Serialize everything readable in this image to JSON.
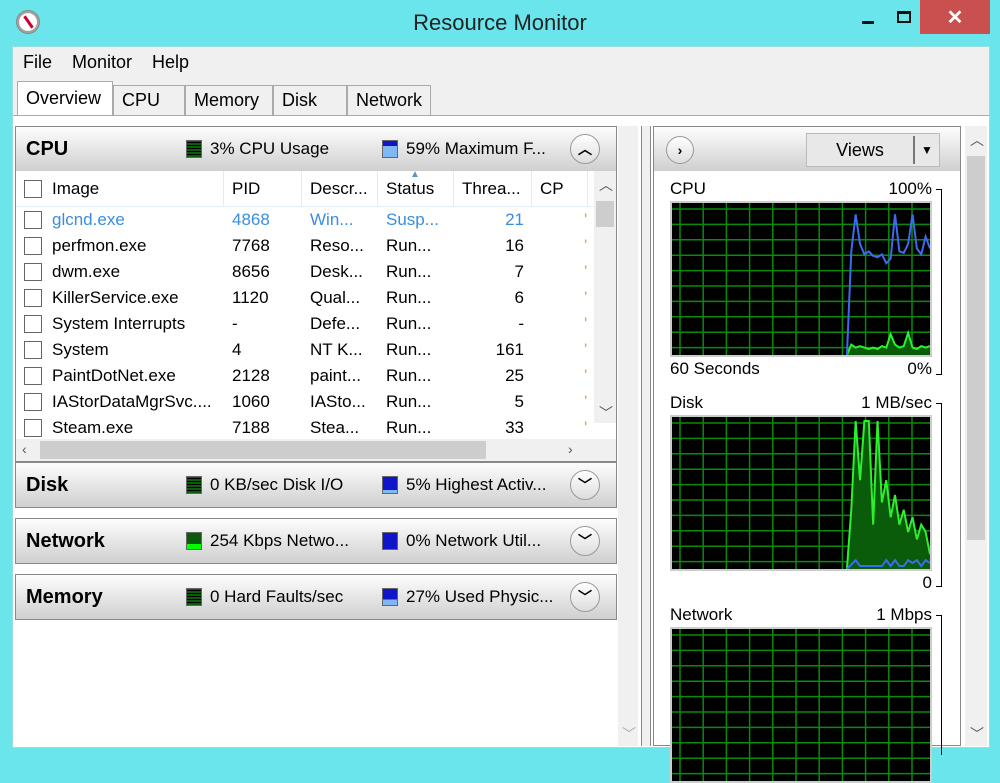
{
  "window": {
    "title": "Resource Monitor",
    "minimize": "–",
    "maximize": "☐",
    "close": "✕"
  },
  "menu": [
    "File",
    "Monitor",
    "Help"
  ],
  "tabs": [
    "Overview",
    "CPU",
    "Memory",
    "Disk",
    "Network"
  ],
  "active_tab": "Overview",
  "sections": {
    "cpu": {
      "name": "CPU",
      "metric1": "3% CPU Usage",
      "metric2": "59% Maximum F...",
      "expanded": true
    },
    "disk": {
      "name": "Disk",
      "metric1": "0 KB/sec Disk I/O",
      "metric2": "5% Highest Activ...",
      "expanded": false
    },
    "network": {
      "name": "Network",
      "metric1": "254 Kbps Netwo...",
      "metric2": "0% Network Util...",
      "expanded": false
    },
    "memory": {
      "name": "Memory",
      "metric1": "0 Hard Faults/sec",
      "metric2": "27% Used Physic...",
      "expanded": false
    }
  },
  "cpu_table": {
    "columns": [
      "Image",
      "PID",
      "Descr...",
      "Status",
      "Threa...",
      "CP"
    ],
    "rows": [
      {
        "image": "glcnd.exe",
        "pid": "4868",
        "desc": "Win...",
        "status": "Susp...",
        "threads": "21",
        "selected": true
      },
      {
        "image": "perfmon.exe",
        "pid": "7768",
        "desc": "Reso...",
        "status": "Run...",
        "threads": "16"
      },
      {
        "image": "dwm.exe",
        "pid": "8656",
        "desc": "Desk...",
        "status": "Run...",
        "threads": "7"
      },
      {
        "image": "KillerService.exe",
        "pid": "1120",
        "desc": "Qual...",
        "status": "Run...",
        "threads": "6"
      },
      {
        "image": "System Interrupts",
        "pid": "-",
        "desc": "Defe...",
        "status": "Run...",
        "threads": "-"
      },
      {
        "image": "System",
        "pid": "4",
        "desc": "NT K...",
        "status": "Run...",
        "threads": "161"
      },
      {
        "image": "PaintDotNet.exe",
        "pid": "2128",
        "desc": "paint...",
        "status": "Run...",
        "threads": "25"
      },
      {
        "image": "IAStorDataMgrSvc....",
        "pid": "1060",
        "desc": "IASto...",
        "status": "Run...",
        "threads": "5"
      },
      {
        "image": "Steam.exe",
        "pid": "7188",
        "desc": "Stea...",
        "status": "Run...",
        "threads": "33"
      }
    ]
  },
  "right_panel": {
    "views_label": "Views"
  },
  "graphs": {
    "cpu": {
      "title": "CPU",
      "max": "100%",
      "footer_left": "60 Seconds",
      "footer_right": "0%",
      "blue": [
        0,
        0,
        0,
        0,
        0,
        0,
        0,
        0,
        0,
        0,
        0,
        0,
        0,
        0,
        0,
        0,
        0,
        0,
        0,
        0,
        0,
        0,
        0,
        0,
        0,
        0,
        0,
        0,
        0,
        0,
        0,
        0,
        0,
        0,
        0,
        0,
        0,
        0,
        0,
        0,
        0,
        70,
        95,
        75,
        68,
        70,
        67,
        66,
        68,
        62,
        65,
        95,
        70,
        69,
        75,
        95,
        72,
        68,
        80,
        72
      ],
      "green": [
        0,
        0,
        0,
        0,
        0,
        0,
        0,
        0,
        0,
        0,
        0,
        0,
        0,
        0,
        0,
        0,
        0,
        0,
        0,
        0,
        0,
        0,
        0,
        0,
        0,
        0,
        0,
        0,
        0,
        0,
        0,
        0,
        0,
        0,
        0,
        0,
        0,
        0,
        0,
        0,
        0,
        7,
        5,
        6,
        5,
        4,
        5,
        4,
        6,
        5,
        14,
        7,
        5,
        6,
        15,
        5,
        4,
        6,
        5,
        6
      ]
    },
    "disk": {
      "title": "Disk",
      "max": "1 MB/sec",
      "footer_right": "0",
      "green": [
        0,
        0,
        0,
        0,
        0,
        0,
        0,
        0,
        0,
        0,
        0,
        0,
        0,
        0,
        0,
        0,
        0,
        0,
        0,
        0,
        0,
        0,
        0,
        0,
        0,
        0,
        0,
        0,
        0,
        0,
        0,
        0,
        0,
        0,
        0,
        0,
        0,
        0,
        0,
        0,
        0,
        40,
        100,
        60,
        100,
        100,
        30,
        100,
        45,
        60,
        35,
        50,
        30,
        40,
        25,
        35,
        20,
        30,
        25,
        10
      ],
      "blue": [
        0,
        0,
        0,
        0,
        0,
        0,
        0,
        0,
        0,
        0,
        0,
        0,
        0,
        0,
        0,
        0,
        0,
        0,
        0,
        0,
        0,
        0,
        0,
        0,
        0,
        0,
        0,
        0,
        0,
        0,
        0,
        0,
        0,
        0,
        0,
        0,
        0,
        0,
        0,
        0,
        0,
        3,
        6,
        2,
        2,
        2,
        2,
        2,
        2,
        6,
        2,
        6,
        2,
        2,
        6,
        4,
        6,
        2,
        6,
        4
      ]
    },
    "network": {
      "title": "Network",
      "max": "1 Mbps"
    }
  }
}
